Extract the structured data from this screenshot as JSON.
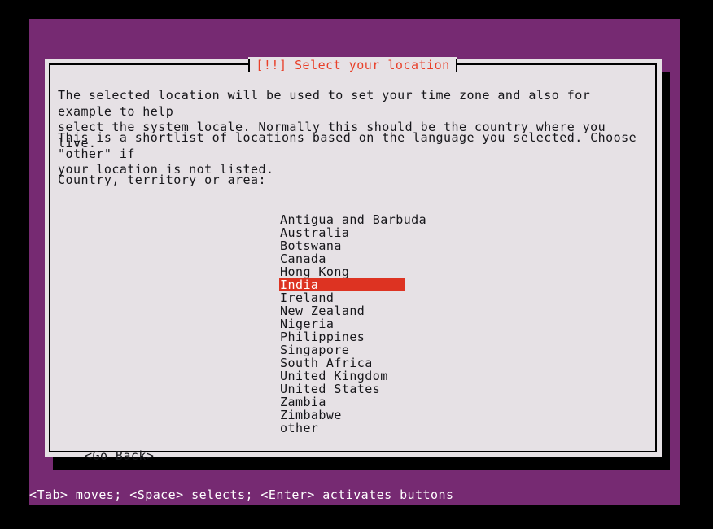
{
  "theme": {
    "screen_bg": "#000000",
    "installer_purple": "#762a72",
    "dialog_bg": "#e6e1e5",
    "dialog_border": "#000000",
    "title_color": "#e8402a",
    "text_color": "#16161a",
    "highlight_bg": "#dd3322",
    "highlight_fg": "#ffffff",
    "status_text_color": "#ffffff"
  },
  "dialog": {
    "title": "[!!] Select your location",
    "paragraphs": [
      "The selected location will be used to set your time zone and also for example to help\nselect the system locale. Normally this should be the country where you live.",
      "This is a shortlist of locations based on the language you selected. Choose \"other\" if\nyour location is not listed."
    ],
    "prompt_label": "Country, territory or area:",
    "countries": [
      "Antigua and Barbuda",
      "Australia",
      "Botswana",
      "Canada",
      "Hong Kong",
      "India",
      "Ireland",
      "New Zealand",
      "Nigeria",
      "Philippines",
      "Singapore",
      "South Africa",
      "United Kingdom",
      "United States",
      "Zambia",
      "Zimbabwe",
      "other"
    ],
    "selected_country": "India",
    "selected_index": 5,
    "buttons": {
      "go_back": "<Go Back>"
    }
  },
  "status_bar": {
    "hint": "<Tab> moves; <Space> selects; <Enter> activates buttons"
  }
}
